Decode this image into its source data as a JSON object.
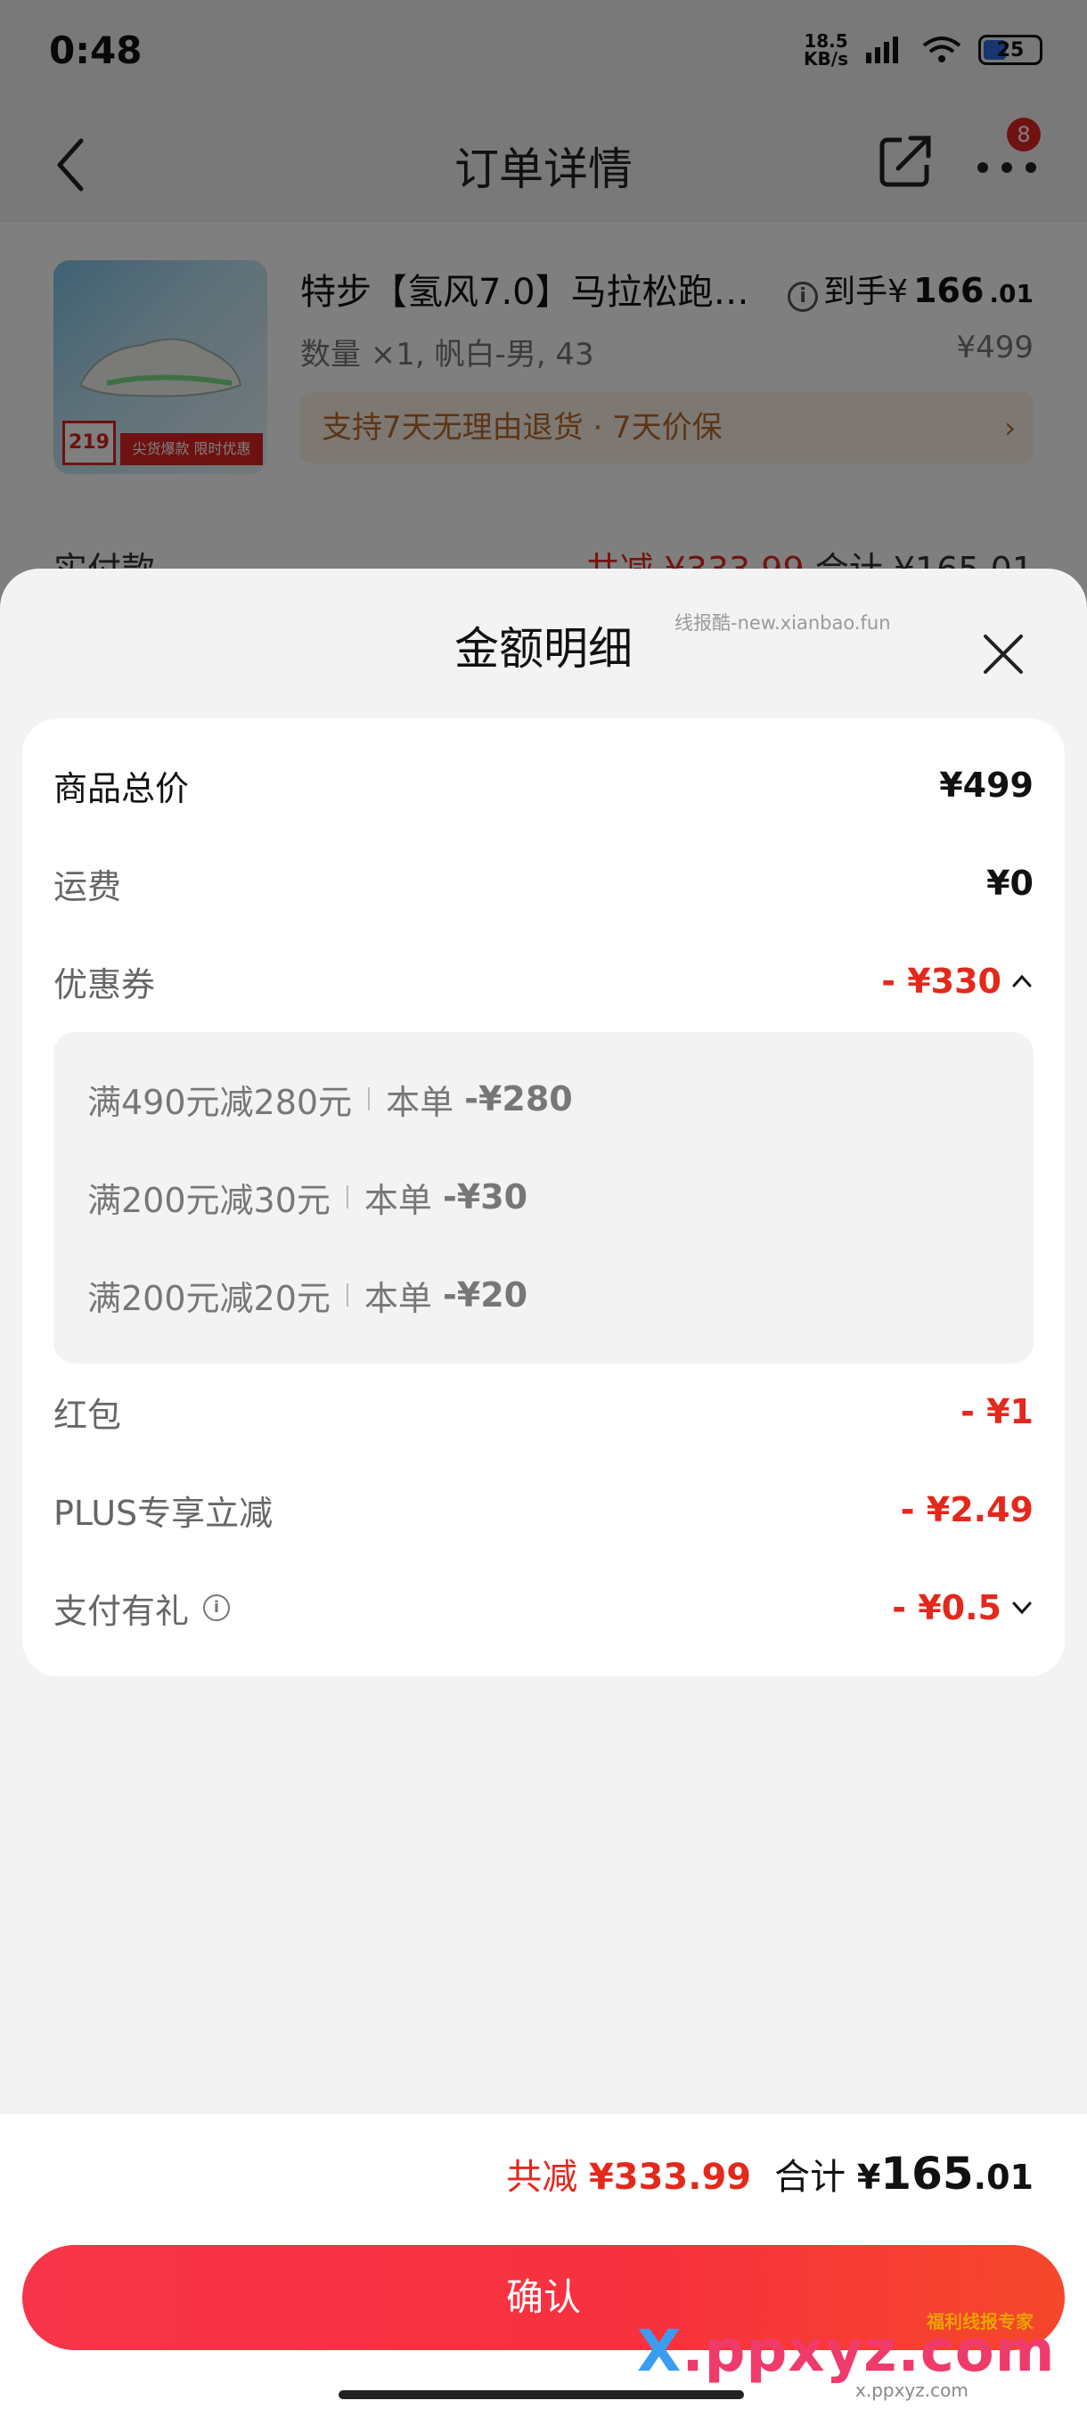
{
  "status_bar": {
    "time": "0:48",
    "net_speed_value": "18.5",
    "net_speed_unit": "KB/s",
    "battery": "25"
  },
  "nav": {
    "title": "订单详情",
    "badge": "8"
  },
  "product": {
    "title": "特步【氢风7.0】马拉松跑…",
    "price_prefix": "到手¥",
    "price_int": "166",
    "price_dec": ".01",
    "spec": "数量 ×1, 帆白-男, 43",
    "original_price": "¥499",
    "service": "支持7天无理由退货 · 7天价保",
    "image_tag_price": "219",
    "image_promo": "尖货爆款 限时优惠"
  },
  "paid_row": {
    "label": "实付款",
    "discount": "共减 ¥333.99",
    "total": "合计 ¥165.01"
  },
  "sheet": {
    "title": "金额明细",
    "watermark": "线报酷-new.xianbao.fun",
    "rows": {
      "goods_total": {
        "label": "商品总价",
        "value": "¥499"
      },
      "shipping": {
        "label": "运费",
        "value": "¥0"
      },
      "coupon": {
        "label": "优惠券",
        "value": "- ¥330"
      },
      "red_packet": {
        "label": "红包",
        "value": "- ¥1"
      },
      "plus": {
        "label": "PLUS专享立减",
        "value": "- ¥2.49"
      },
      "pay_gift": {
        "label": "支付有礼",
        "value": "- ¥0.5"
      }
    },
    "coupons": [
      {
        "rule": "满490元减280元",
        "scope": "本单",
        "amount": "-¥280"
      },
      {
        "rule": "满200元减30元",
        "scope": "本单",
        "amount": "-¥30"
      },
      {
        "rule": "满200元减20元",
        "scope": "本单",
        "amount": "-¥20"
      }
    ]
  },
  "footer": {
    "discount_label": "共减",
    "discount_value": "¥333.99",
    "total_label": "合计",
    "total_yen": "¥",
    "total_int": "165",
    "total_dec": ".01",
    "confirm": "确认"
  },
  "overlay_logo": {
    "text_x": "X",
    "text_rest": ".ppxyz.com",
    "tag": "福利线报专家",
    "sub": "x.ppxyz.com"
  },
  "colors": {
    "accent_red": "#e3281c",
    "button_gradient_start": "#f8344a",
    "button_gradient_end": "#f5472a",
    "battery_fill": "#2f6ce0",
    "badge": "#e02424"
  },
  "icons": [
    "back-arrow-icon",
    "share-icon",
    "more-icon",
    "info-icon",
    "chevron-right-icon",
    "close-icon",
    "chevron-up-icon",
    "chevron-down-icon",
    "signal-icon",
    "wifi-icon"
  ]
}
